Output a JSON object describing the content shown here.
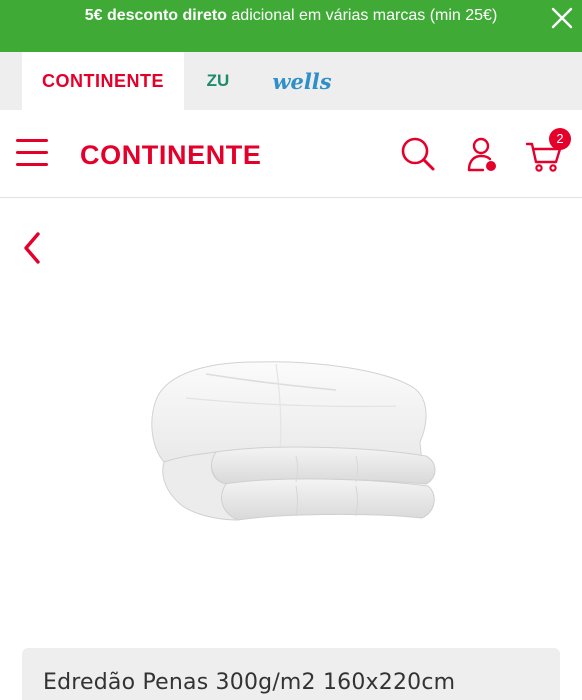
{
  "promo": {
    "highlight": "5€ desconto direto",
    "text": " adicional em várias marcas (min 25€)"
  },
  "brands": {
    "continente": "CONTINENTE",
    "zu": "ZU",
    "wells": "wells"
  },
  "header": {
    "logo": "CONTINENTE",
    "cart_count": "2"
  },
  "product": {
    "title": "Edredão Penas 300g/m2 160x220cm"
  },
  "icons": {
    "promo_close": "close-icon",
    "menu": "hamburger-menu-icon",
    "search": "search-icon",
    "account": "user-icon",
    "cart": "shopping-cart-icon",
    "back": "chevron-left-icon"
  },
  "colors": {
    "promo_bg": "#3fab36",
    "brand_red": "#e4002b",
    "zu_green": "#1e8a6e",
    "wells_blue": "#2e8fc9"
  }
}
